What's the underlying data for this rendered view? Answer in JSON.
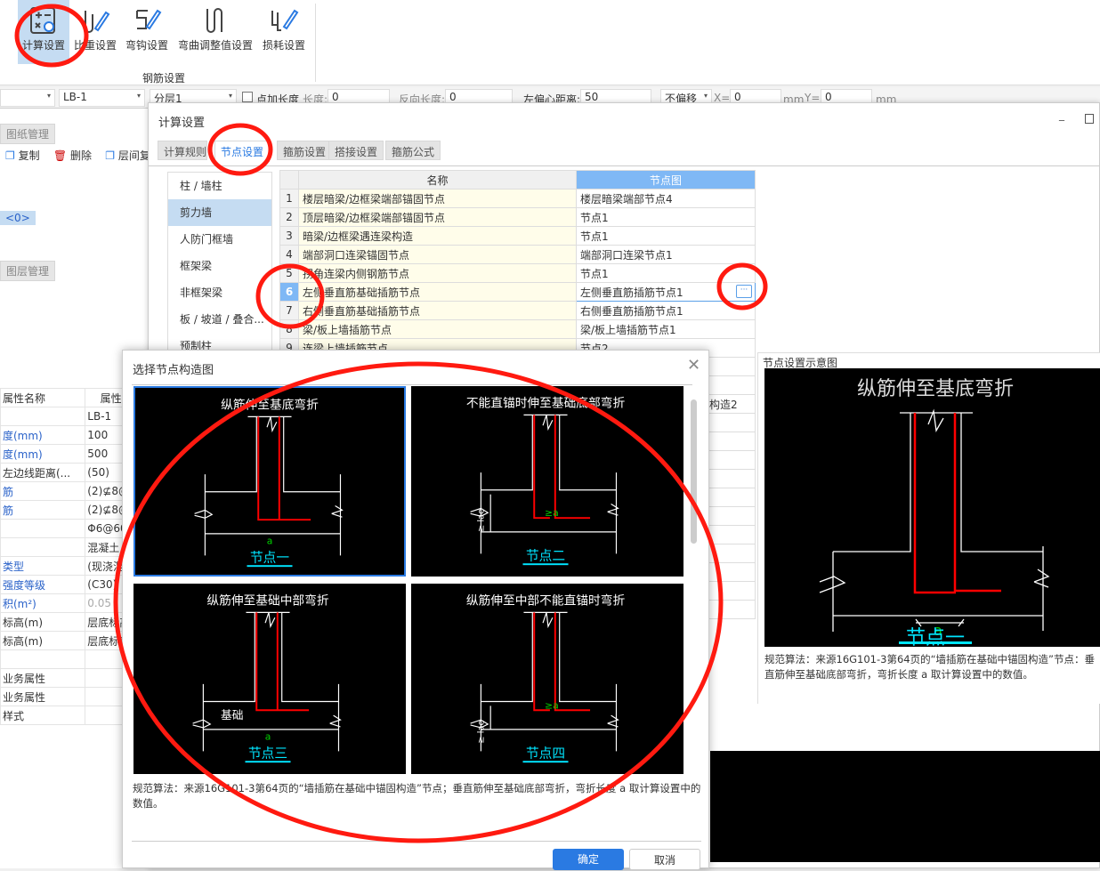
{
  "ribbon": {
    "buttons": [
      {
        "label": "计算设置",
        "icon": "calc-settings-icon",
        "selected": true
      },
      {
        "label": "比重设置",
        "icon": "weight-settings-icon"
      },
      {
        "label": "弯钩设置",
        "icon": "hook-settings-icon"
      },
      {
        "label": "弯曲调整值设置",
        "icon": "bend-adjust-icon"
      },
      {
        "label": "损耗设置",
        "icon": "loss-settings-icon"
      }
    ],
    "group_label": "钢筋设置"
  },
  "toolbar": {
    "component": "LB-1",
    "layer": "分层1",
    "extra_length_label": "点加长度",
    "length_label": "长度:",
    "length_value": "0",
    "reverse_length_label": "反向长度:",
    "reverse_length_value": "0",
    "offset_label": "左偏心距离:",
    "offset_value": "50",
    "offset_mode": "不偏移",
    "x_label": "X=",
    "x_value": "0",
    "mm1": "mm",
    "y_label": "Y=",
    "y_value": "0",
    "mm2": "mm"
  },
  "left_panel": {
    "drawing_tab": "图纸管理",
    "actions": [
      "复制",
      "删除",
      "层间复"
    ],
    "badge": "<0>",
    "layer_tab": "图层管理",
    "prop_header": [
      "属性名称",
      "属性值"
    ],
    "props": [
      [
        "",
        "LB-1",
        ""
      ],
      [
        "度(mm)",
        "100",
        "b"
      ],
      [
        "度(mm)",
        "500",
        "b"
      ],
      [
        "左边线距离(...",
        "(50)",
        ""
      ],
      [
        "筋",
        "(2)⊈8@2",
        "b"
      ],
      [
        "筋",
        "(2)⊈8@2",
        "b"
      ],
      [
        "",
        "Φ6@600",
        ""
      ],
      [
        "",
        "混凝土",
        ""
      ],
      [
        "类型",
        "(现浇混凝",
        "b"
      ],
      [
        "强度等级",
        "(C30)",
        "b"
      ],
      [
        "积(m²)",
        "0.05",
        "b"
      ],
      [
        "标高(m)",
        "层底标高",
        ""
      ],
      [
        "标高(m)",
        "层底标高",
        ""
      ],
      [
        "",
        "",
        ""
      ],
      [
        "业务属性",
        "",
        ""
      ],
      [
        "业务属性",
        "",
        ""
      ],
      [
        "样式",
        "",
        ""
      ]
    ]
  },
  "calc_dialog": {
    "title": "计算设置",
    "tabs": [
      "计算规则",
      "节点设置",
      "箍筋设置",
      "搭接设置",
      "箍筋公式"
    ],
    "active_tab": 1,
    "categories": [
      "柱 / 墙柱",
      "剪力墙",
      "人防门框墙",
      "框架梁",
      "非框架梁",
      "板 / 坡道 / 叠合...",
      "预制柱"
    ],
    "selected_category": 1,
    "grid_header": [
      "名称",
      "节点图"
    ],
    "rows": [
      [
        "1",
        "楼层暗梁/边框梁端部锚固节点",
        "楼层暗梁端部节点4"
      ],
      [
        "2",
        "顶层暗梁/边框梁端部锚固节点",
        "节点1"
      ],
      [
        "3",
        "暗梁/边框梁遇连梁构造",
        "节点1"
      ],
      [
        "4",
        "端部洞口连梁锚固节点",
        "端部洞口连梁节点1"
      ],
      [
        "5",
        "拐角连梁内侧钢筋节点",
        "节点1"
      ],
      [
        "6",
        "左侧垂直筋基础插筋节点",
        "左侧垂直筋插筋节点1"
      ],
      [
        "7",
        "右侧垂直筋基础插筋节点",
        "右侧垂直筋插筋节点1"
      ],
      [
        "8",
        "梁/板上墙插筋节点",
        "梁/板上墙插筋节点1"
      ],
      [
        "9",
        "连梁上墙插筋节点",
        "节点2"
      ]
    ],
    "selected_row": 6,
    "hidden_cell": "构造2",
    "preview_title": "节点设置示意图",
    "preview_diagram_title": "纵筋伸至基底弯折",
    "preview_node_label": "节点一",
    "preview_dim": "a",
    "preview_desc": "规范算法：来源16G101-3第64页的“墙插筋在基础中锚固构造”节点：垂直筋伸至基础底部弯折，弯折长度 a 取计算设置中的数值。"
  },
  "node_dialog": {
    "title": "选择节点构造图",
    "tiles": [
      {
        "title": "纵筋伸至基底弯折",
        "label": "节点一",
        "dim": "a",
        "selected": true
      },
      {
        "title": "不能直锚时伸至基础底部弯折",
        "label": "节点二",
        "dim": "≥a",
        "lae": "≥ lae"
      },
      {
        "title": "纵筋伸至基础中部弯折",
        "label": "节点三",
        "dim": "a",
        "base": "基础"
      },
      {
        "title": "纵筋伸至中部不能直锚时弯折",
        "label": "节点四",
        "dim": "≥a",
        "lae": "≥ lae"
      }
    ],
    "desc": "规范算法：来源16G101-3第64页的“墙插筋在基础中锚固构造”节点；垂直筋伸至基础底部弯折，弯折长度 a 取计算设置中的数值。",
    "ok": "确定",
    "cancel": "取消"
  },
  "colors": {
    "accent": "#2a7ae2",
    "rebar": "#ff0000",
    "annotation": "#ff1a10",
    "label": "#00e5ff",
    "dim": "#00d000"
  }
}
